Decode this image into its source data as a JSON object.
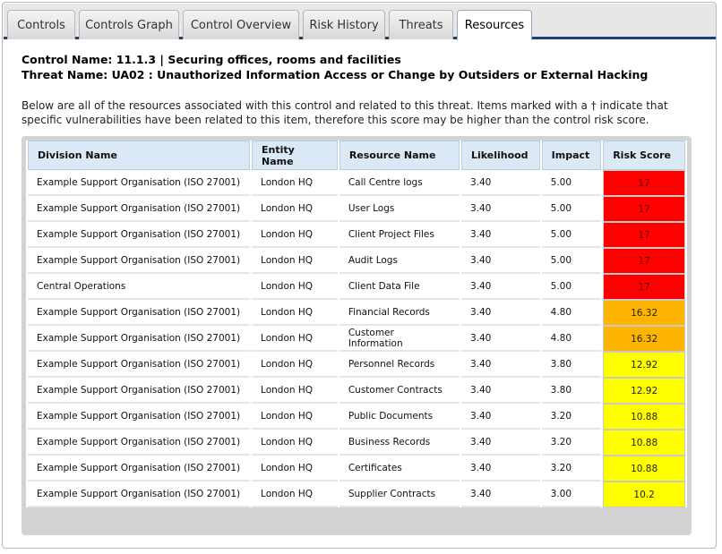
{
  "tabs": [
    {
      "label": "Controls"
    },
    {
      "label": "Controls Graph"
    },
    {
      "label": "Control Overview"
    },
    {
      "label": "Risk History"
    },
    {
      "label": "Threats"
    },
    {
      "label": "Resources",
      "active": true
    }
  ],
  "header": {
    "control_name": "Control Name: 11.1.3 | Securing offices, rooms and facilities",
    "threat_name": "Threat Name: UA02 : Unauthorized Information Access or Change by Outsiders or External Hacking",
    "description": "Below are all of the resources associated with this control and related to this threat. Items marked with a † indicate that specific vulnerabilities have been related to this item, therefore this score may be higher than the control risk score."
  },
  "table": {
    "columns": [
      "Division Name",
      "Entity Name",
      "Resource Name",
      "Likelihood",
      "Impact",
      "Risk Score"
    ],
    "rows": [
      {
        "division": "Example Support Organisation (ISO 27001)",
        "entity": "London HQ",
        "resource": "Call Centre logs",
        "likelihood": "3.40",
        "impact": "5.00",
        "score": "17",
        "level": "red"
      },
      {
        "division": "Example Support Organisation (ISO 27001)",
        "entity": "London HQ",
        "resource": "User Logs",
        "likelihood": "3.40",
        "impact": "5.00",
        "score": "17",
        "level": "red"
      },
      {
        "division": "Example Support Organisation (ISO 27001)",
        "entity": "London HQ",
        "resource": "Client Project Files",
        "likelihood": "3.40",
        "impact": "5.00",
        "score": "17",
        "level": "red"
      },
      {
        "division": "Example Support Organisation (ISO 27001)",
        "entity": "London HQ",
        "resource": "Audit Logs",
        "likelihood": "3.40",
        "impact": "5.00",
        "score": "17",
        "level": "red"
      },
      {
        "division": "Central Operations",
        "entity": "London HQ",
        "resource": "Client Data File",
        "likelihood": "3.40",
        "impact": "5.00",
        "score": "17",
        "level": "red"
      },
      {
        "division": "Example Support Organisation (ISO 27001)",
        "entity": "London HQ",
        "resource": "Financial Records",
        "likelihood": "3.40",
        "impact": "4.80",
        "score": "16.32",
        "level": "orange"
      },
      {
        "division": "Example Support Organisation (ISO 27001)",
        "entity": "London HQ",
        "resource": "Customer Information",
        "likelihood": "3.40",
        "impact": "4.80",
        "score": "16.32",
        "level": "orange"
      },
      {
        "division": "Example Support Organisation (ISO 27001)",
        "entity": "London HQ",
        "resource": "Personnel Records",
        "likelihood": "3.40",
        "impact": "3.80",
        "score": "12.92",
        "level": "yellow"
      },
      {
        "division": "Example Support Organisation (ISO 27001)",
        "entity": "London HQ",
        "resource": "Customer Contracts",
        "likelihood": "3.40",
        "impact": "3.80",
        "score": "12.92",
        "level": "yellow"
      },
      {
        "division": "Example Support Organisation (ISO 27001)",
        "entity": "London HQ",
        "resource": "Public Documents",
        "likelihood": "3.40",
        "impact": "3.20",
        "score": "10.88",
        "level": "yellow"
      },
      {
        "division": "Example Support Organisation (ISO 27001)",
        "entity": "London HQ",
        "resource": "Business Records",
        "likelihood": "3.40",
        "impact": "3.20",
        "score": "10.88",
        "level": "yellow"
      },
      {
        "division": "Example Support Organisation (ISO 27001)",
        "entity": "London HQ",
        "resource": "Certificates",
        "likelihood": "3.40",
        "impact": "3.20",
        "score": "10.88",
        "level": "yellow"
      },
      {
        "division": "Example Support Organisation (ISO 27001)",
        "entity": "London HQ",
        "resource": "Supplier Contracts",
        "likelihood": "3.40",
        "impact": "3.00",
        "score": "10.2",
        "level": "yellow"
      }
    ]
  },
  "colors": {
    "accent": "#1f3f7a",
    "red": "#ff0000",
    "orange": "#ffb400",
    "yellow": "#ffff00"
  }
}
